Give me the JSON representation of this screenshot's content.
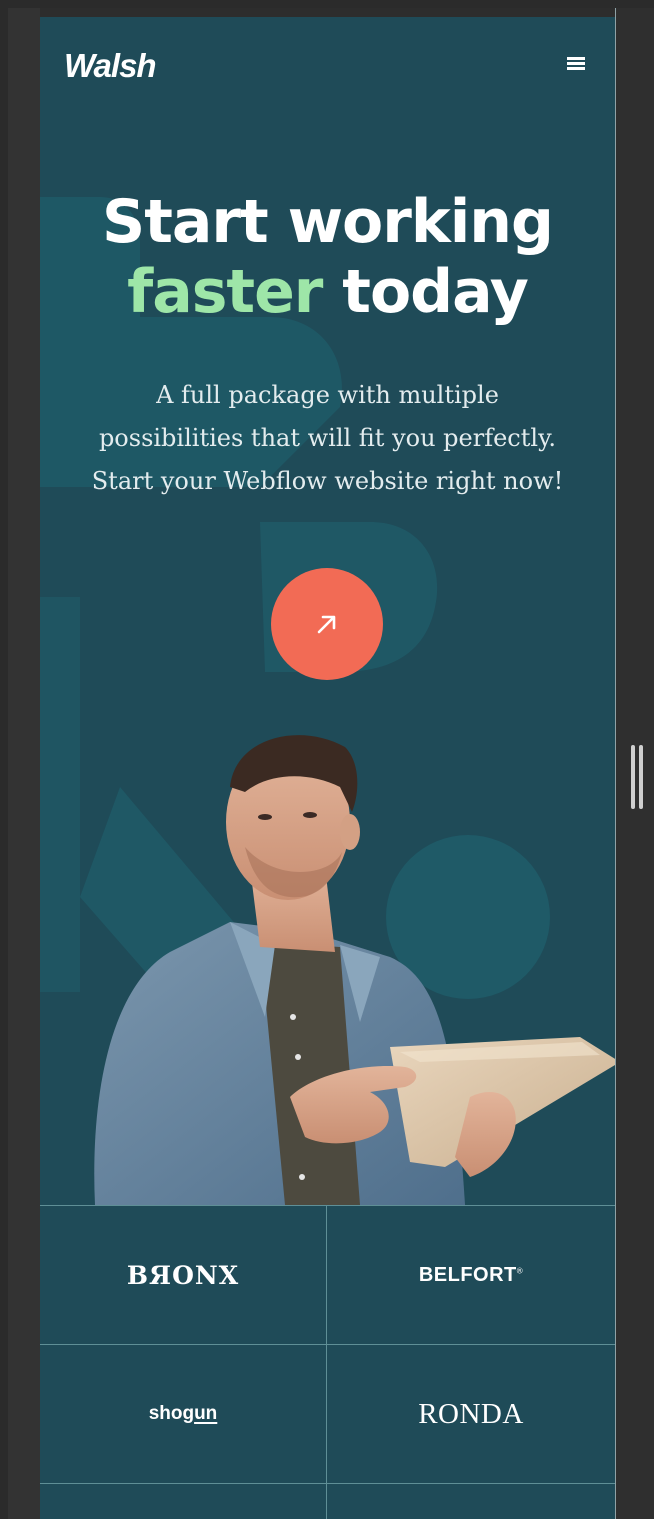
{
  "header": {
    "logo": "Walsh"
  },
  "hero": {
    "title_line1": "Start working",
    "title_accent": "faster",
    "title_rest": "today",
    "subtitle_line1": "A full package with multiple",
    "subtitle_line2": "possibilities that will fit you perfectly.",
    "subtitle_line3": "Start your Webflow website right now!"
  },
  "logos": {
    "bronx": "BЯONX",
    "belfort": "BELFORT",
    "belfort_mark": "®",
    "shogun_a": "shog",
    "shogun_b": "un",
    "ronda": "RONDA"
  },
  "colors": {
    "background": "#1f4b58",
    "accent_green": "#9ee6a8",
    "cta": "#f26b55"
  },
  "icons": {
    "menu": "hamburger-icon",
    "cta": "arrow-up-right-icon"
  }
}
